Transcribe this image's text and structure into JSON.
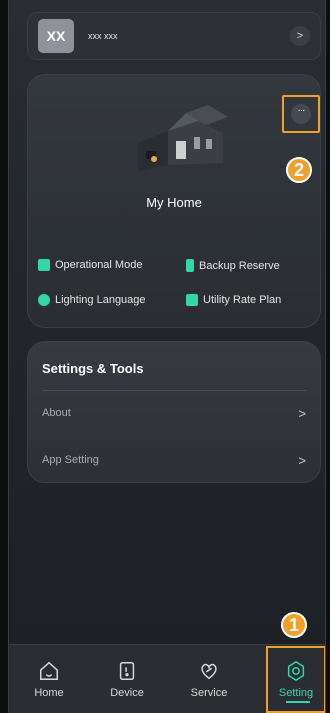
{
  "user": {
    "avatar_text": "XX",
    "name": "xxx xxx"
  },
  "home": {
    "title": "My Home",
    "more_label": "···",
    "features": [
      {
        "label": "Operational Mode",
        "icon": "mode-icon"
      },
      {
        "label": "Backup Reserve",
        "icon": "battery-icon"
      },
      {
        "label": "Lighting Language",
        "icon": "lighting-icon"
      },
      {
        "label": "Utility Rate Plan",
        "icon": "rate-plan-icon"
      }
    ]
  },
  "settings": {
    "title": "Settings & Tools",
    "rows": [
      {
        "label": "About"
      },
      {
        "label": "App Setting"
      }
    ],
    "chevron": ">"
  },
  "nav": {
    "items": [
      {
        "label": "Home",
        "icon": "home-icon"
      },
      {
        "label": "Device",
        "icon": "device-icon"
      },
      {
        "label": "Service",
        "icon": "service-icon"
      },
      {
        "label": "Setting",
        "icon": "gear-icon",
        "active": true
      }
    ]
  },
  "annotations": {
    "badge_1": "1",
    "badge_2": "2"
  },
  "colors": {
    "accent": "#34d6a8",
    "highlight": "#f0a12b",
    "background": "#23272c"
  }
}
